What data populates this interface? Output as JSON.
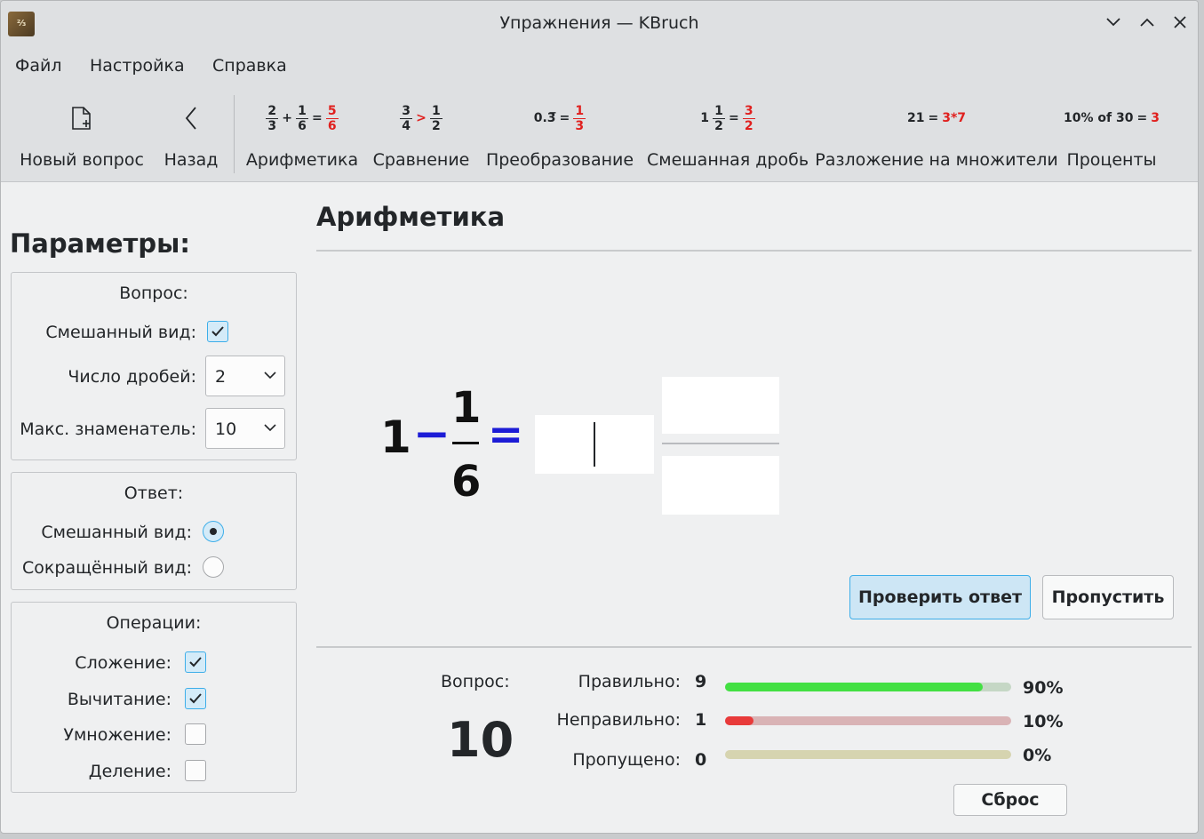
{
  "window": {
    "title": "Упражнения — KBruch",
    "app_icon_text": "⅔",
    "controls": [
      "minimize",
      "maximize",
      "close"
    ]
  },
  "menu": {
    "file": "Файл",
    "settings": "Настройка",
    "help": "Справка"
  },
  "toolbar": {
    "new_question": "Новый вопрос",
    "back": "Назад",
    "arithmetic": "Арифметика",
    "comparison": "Сравнение",
    "conversion": "Преобразование",
    "mixed_number": "Смешанная дробь",
    "factorization": "Разложение на множители",
    "percentage": "Проценты",
    "icons": {
      "arithmetic": {
        "a_num": "2",
        "a_den": "3",
        "op": "+",
        "b_num": "1",
        "b_den": "6",
        "eq": "=",
        "r_num": "5",
        "r_den": "6"
      },
      "comparison": {
        "a_num": "3",
        "a_den": "4",
        "op": ">",
        "b_num": "1",
        "b_den": "2"
      },
      "conversion": {
        "left": "0.3̅",
        "eq": "=",
        "r_num": "1",
        "r_den": "3"
      },
      "mixed": {
        "whole": "1",
        "a_num": "1",
        "a_den": "2",
        "eq": "=",
        "r_num": "3",
        "r_den": "2"
      },
      "factorization": {
        "left": "21",
        "eq": "=",
        "right": "3*7"
      },
      "percentage": {
        "left": "10% of 30",
        "eq": "=",
        "right": "3"
      }
    }
  },
  "params": {
    "title": "Параметры:",
    "question_group": {
      "title": "Вопрос:",
      "mixed_label": "Смешанный вид:",
      "mixed_checked": true,
      "num_fractions_label": "Число дробей:",
      "num_fractions_value": "2",
      "max_denominator_label": "Макс. знаменатель:",
      "max_denominator_value": "10"
    },
    "answer_group": {
      "title": "Ответ:",
      "mixed_label": "Смешанный вид:",
      "mixed_selected": true,
      "reduced_label": "Сокращённый вид:",
      "reduced_selected": false
    },
    "operations_group": {
      "title": "Операции:",
      "addition_label": "Сложение:",
      "addition_checked": true,
      "subtraction_label": "Вычитание:",
      "subtraction_checked": true,
      "multiplication_label": "Умножение:",
      "multiplication_checked": false,
      "division_label": "Деление:",
      "division_checked": false
    }
  },
  "exercise": {
    "title": "Арифметика",
    "whole": "1",
    "operator": "−",
    "numerator": "1",
    "denominator": "6",
    "equals": "=",
    "answer_whole": "",
    "answer_numerator": "",
    "answer_denominator": ""
  },
  "buttons": {
    "check": "Проверить ответ",
    "skip": "Пропустить",
    "reset": "Сброс"
  },
  "stats": {
    "question_label": "Вопрос:",
    "question_number": "10",
    "correct_label": "Правильно:",
    "correct_count": "9",
    "correct_pct": "90%",
    "correct_fraction": 0.9,
    "incorrect_label": "Неправильно:",
    "incorrect_count": "1",
    "incorrect_pct": "10%",
    "incorrect_fraction": 0.1,
    "skipped_label": "Пропущено:",
    "skipped_count": "0",
    "skipped_pct": "0%",
    "skipped_fraction": 0.0,
    "colors": {
      "correct": "#43e043",
      "correct_track": "#c5d7c5",
      "incorrect": "#e83a3a",
      "incorrect_track": "#d9b3b5",
      "skipped_track": "#d6d4b0"
    }
  }
}
